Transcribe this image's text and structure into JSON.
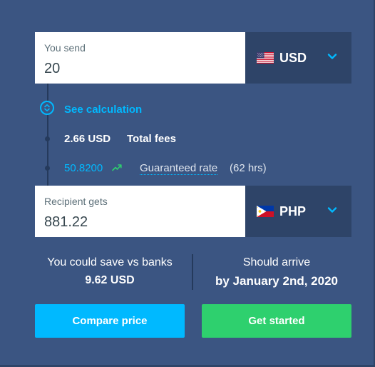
{
  "send": {
    "label": "You send",
    "amount": "20",
    "currency": "USD",
    "flag_icon": "us-flag-icon"
  },
  "receive": {
    "label": "Recipient gets",
    "amount": "881.22",
    "currency": "PHP",
    "flag_icon": "ph-flag-icon"
  },
  "calculation": {
    "see_calculation": "See calculation",
    "fee_amount": "2.66 USD",
    "fee_label": "Total fees",
    "rate_value": "50.8200",
    "rate_label": "Guaranteed rate",
    "rate_hours": "(62 hrs)"
  },
  "summary": {
    "savings_label": "You could save vs banks",
    "savings_value": "9.62 USD",
    "arrival_label": "Should arrive",
    "arrival_value": "by January 2nd, 2020"
  },
  "buttons": {
    "compare": "Compare price",
    "get_started": "Get started"
  },
  "colors": {
    "background": "#3b5582",
    "currency_panel": "#2e4468",
    "accent_blue": "#00b9ff",
    "accent_green": "#2ed06e"
  }
}
